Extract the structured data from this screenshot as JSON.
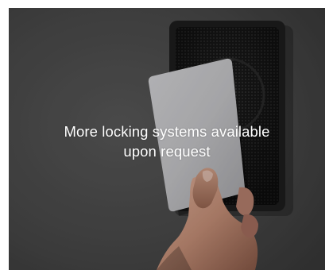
{
  "promo_card": {
    "caption_line1": "More locking systems available",
    "caption_line2": "upon request"
  }
}
